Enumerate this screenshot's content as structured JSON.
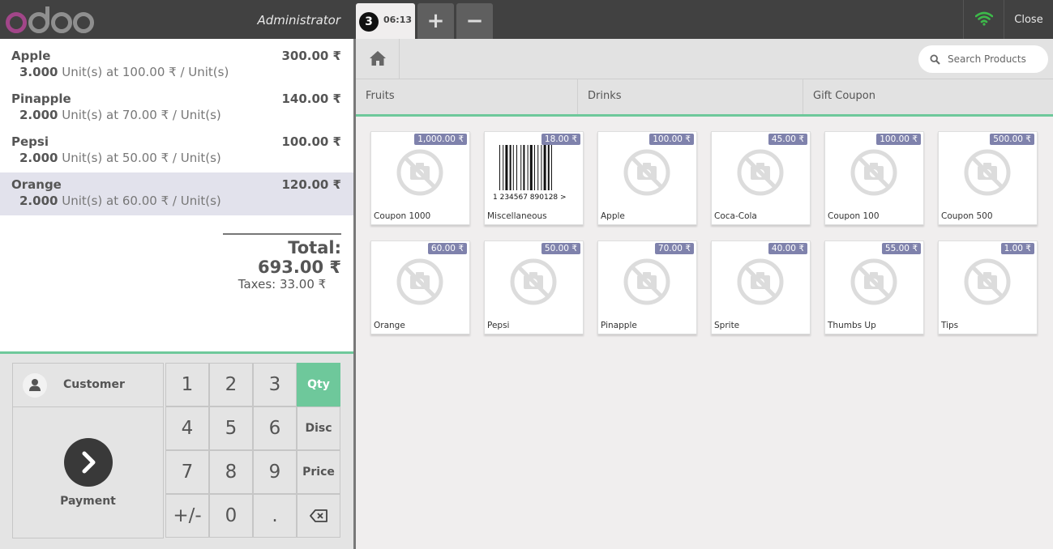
{
  "header": {
    "username": "Administrator",
    "order_number": "3",
    "order_time": "06:13",
    "add_label": "+",
    "remove_label": "−",
    "close_label": "Close",
    "wifi_color": "#3db94a"
  },
  "orderlines": [
    {
      "name": "Apple",
      "price": "300.00 ₹",
      "qty": "3.000",
      "info": " Unit(s) at 100.00 ₹ / Unit(s)",
      "selected": false
    },
    {
      "name": "Pinapple",
      "price": "140.00 ₹",
      "qty": "2.000",
      "info": " Unit(s) at 70.00 ₹ / Unit(s)",
      "selected": false
    },
    {
      "name": "Pepsi",
      "price": "100.00 ₹",
      "qty": "2.000",
      "info": " Unit(s) at 50.00 ₹ / Unit(s)",
      "selected": false
    },
    {
      "name": "Orange",
      "price": "120.00 ₹",
      "qty": "2.000",
      "info": " Unit(s) at 60.00 ₹ / Unit(s)",
      "selected": true
    }
  ],
  "summary": {
    "total": "Total: 693.00 ₹",
    "taxes": "Taxes: 33.00 ₹"
  },
  "actions": {
    "customer_label": "Customer",
    "payment_label": "Payment"
  },
  "numpad": {
    "keys": [
      "1",
      "2",
      "3",
      "Qty",
      "4",
      "5",
      "6",
      "Disc",
      "7",
      "8",
      "9",
      "Price",
      "+/-",
      "0",
      ".",
      "⌫"
    ],
    "active_mode": "Qty",
    "accent_color": "#6ec89b"
  },
  "search": {
    "placeholder": "Search Products"
  },
  "categories": [
    "Fruits",
    "Drinks",
    "Gift Coupon"
  ],
  "products": [
    {
      "name": "Coupon 1000",
      "price": "1,000.00 ₹",
      "image": "no-image"
    },
    {
      "name": "Miscellaneous",
      "price": "18.00 ₹",
      "image": "barcode"
    },
    {
      "name": "Apple",
      "price": "100.00 ₹",
      "image": "no-image"
    },
    {
      "name": "Coca-Cola",
      "price": "45.00 ₹",
      "image": "no-image"
    },
    {
      "name": "Coupon 100",
      "price": "100.00 ₹",
      "image": "no-image"
    },
    {
      "name": "Coupon 500",
      "price": "500.00 ₹",
      "image": "no-image"
    },
    {
      "name": "Orange",
      "price": "60.00 ₹",
      "image": "no-image"
    },
    {
      "name": "Pepsi",
      "price": "50.00 ₹",
      "image": "no-image"
    },
    {
      "name": "Pinapple",
      "price": "70.00 ₹",
      "image": "no-image"
    },
    {
      "name": "Sprite",
      "price": "40.00 ₹",
      "image": "no-image"
    },
    {
      "name": "Thumbs Up",
      "price": "55.00 ₹",
      "image": "no-image"
    },
    {
      "name": "Tips",
      "price": "1.00 ₹",
      "image": "no-image"
    }
  ],
  "barcode_text": "1 234567 890128 >",
  "logo_text": "odoo"
}
